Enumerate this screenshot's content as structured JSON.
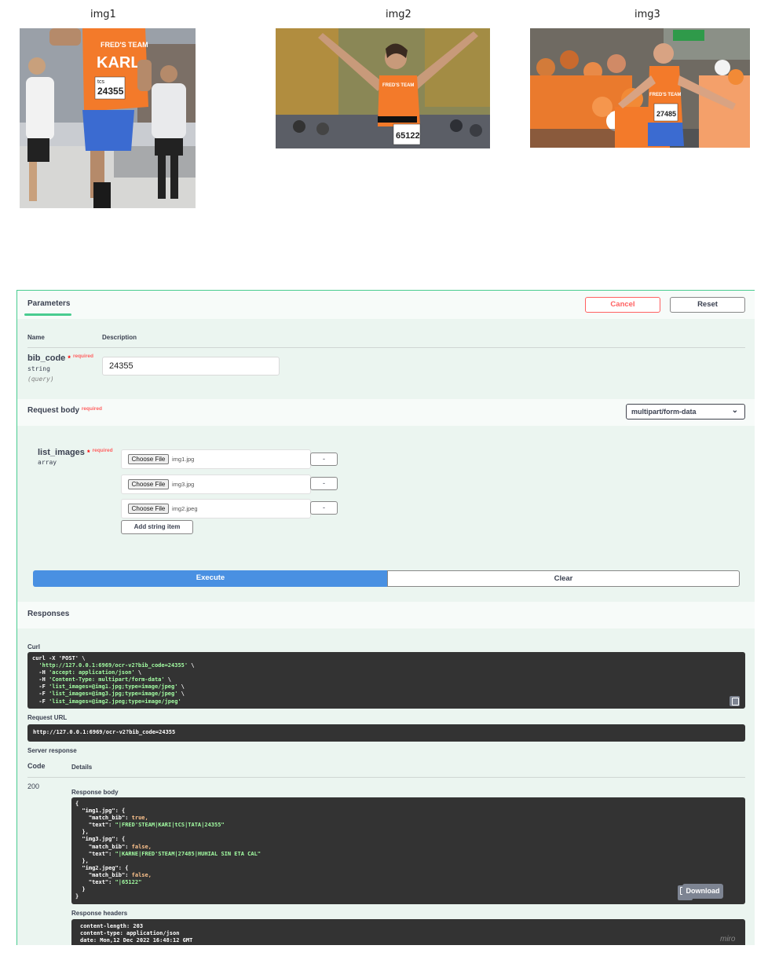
{
  "images": [
    {
      "label": "img1"
    },
    {
      "label": "img2"
    },
    {
      "label": "img3"
    }
  ],
  "photo_text": {
    "img1": [
      "FRED'S TEAM",
      "KARL",
      "tcs",
      "24355"
    ],
    "img2": [
      "FRED'S TEAM",
      "65122"
    ],
    "img3": [
      "FRED'S TEAM",
      "27485"
    ]
  },
  "parameters": {
    "tab_label": "Parameters",
    "cancel_label": "Cancel",
    "reset_label": "Reset",
    "col_name": "Name",
    "col_description": "Description",
    "bib_code": {
      "name": "bib_code",
      "star": "*",
      "required": "required",
      "type": "string",
      "in": "(query)",
      "value": "24355"
    }
  },
  "request_body": {
    "title": "Request body",
    "required": "required",
    "content_type": "multipart/form-data",
    "list_images": {
      "name": "list_images",
      "star": "*",
      "required": "required",
      "type": "array",
      "choose_label": "Choose File",
      "files": [
        "img1.jpg",
        "img3.jpg",
        "img2.jpeg"
      ],
      "remove_label": "-",
      "add_label": "Add string item"
    }
  },
  "actions": {
    "execute_label": "Execute",
    "clear_label": "Clear"
  },
  "responses": {
    "title": "Responses",
    "curl_label": "Curl",
    "curl": {
      "l1": "curl -X 'POST' \\",
      "l2_url": "'http://127.0.0.1:6969/ocr-v2?bib_code=24355'",
      "l2_tail": " \\",
      "l3_flag": "  -H ",
      "l3_val": "'accept: application/json'",
      "l4_flag": "  -H ",
      "l4_val": "'Content-Type: multipart/form-data'",
      "l5_flag": "  -F ",
      "l5_val": "'list_images=@img1.jpg;type=image/jpeg'",
      "l6_flag": "  -F ",
      "l6_val": "'list_images=@img3.jpg;type=image/jpeg'",
      "l7_flag": "  -F ",
      "l7_val": "'list_images=@img2.jpeg;type=image/jpeg'",
      "tail": " \\"
    },
    "request_url_label": "Request URL",
    "request_url": "http://127.0.0.1:6969/ocr-v2?bib_code=24355",
    "server_response_label": "Server response",
    "code_col": "Code",
    "details_col": "Details",
    "code": "200",
    "response_body_label": "Response body",
    "body": {
      "open": "{",
      "k1": "  \"img1.jpg\": {",
      "mb1_key": "    \"match_bib\": ",
      "mb1_val": "true,",
      "tx1_key": "    \"text\": ",
      "tx1_val": "\"|FRED'STEAM|KARI|tCS|TATA|24355\"",
      "c1": "  },",
      "k2": "  \"img3.jpg\": {",
      "mb2_key": "    \"match_bib\": ",
      "mb2_val": "false,",
      "tx2_key": "    \"text\": ",
      "tx2_val": "\"|KARNE|FRED'STEAM|27485|HUHIAL SIN ETA CAL\"",
      "c2": "  },",
      "k3": "  \"img2.jpeg\": {",
      "mb3_key": "    \"match_bib\": ",
      "mb3_val": "false,",
      "tx3_key": "    \"text\": ",
      "tx3_val": "\"|65122\"",
      "c3": "  }",
      "close": "}"
    },
    "download_label": "Download",
    "response_headers_label": "Response headers",
    "headers": {
      "h1": "content-length: 203",
      "h2": "content-type: application/json",
      "h3": "date: Mon,12 Dec 2022 16:48:12 GMT"
    }
  },
  "watermark": "miro",
  "colors": {
    "accent_green": "#49cc90",
    "execute_blue": "#4990e2",
    "cancel_red": "#ff6060",
    "code_bg": "#333333",
    "jersey_orange": "#f37a2a"
  }
}
